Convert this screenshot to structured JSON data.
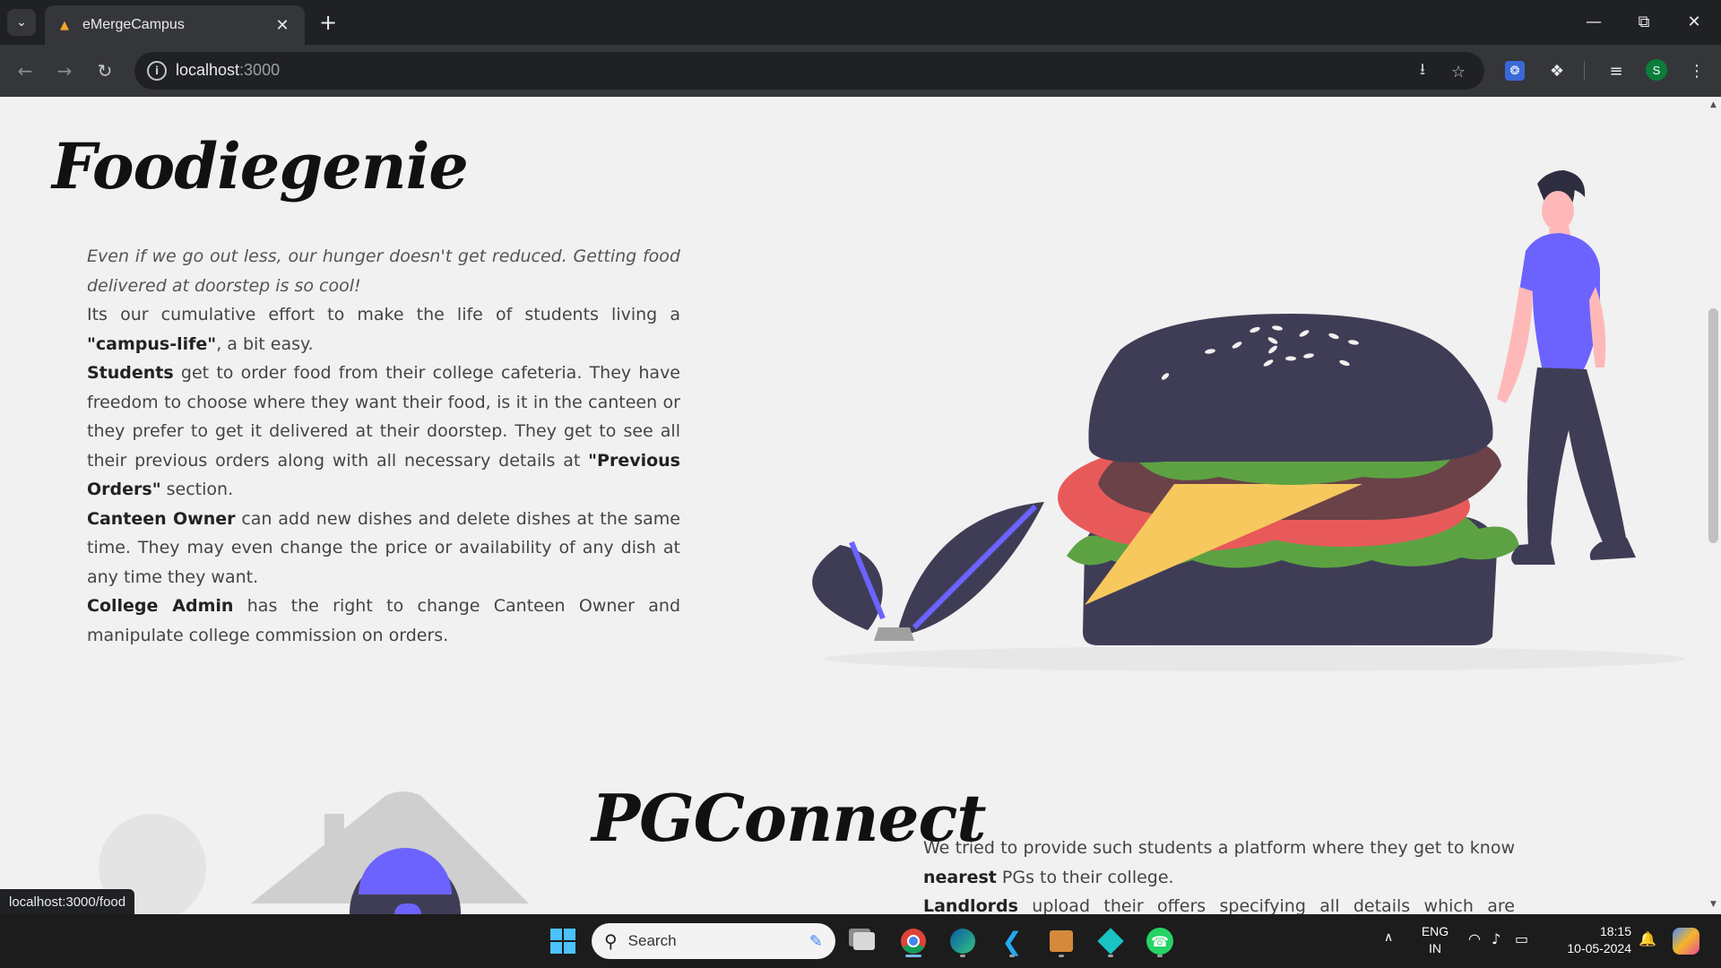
{
  "browser": {
    "tab_title": "eMergeCampus",
    "url_host": "localhost",
    "url_port": ":3000",
    "status_url": "localhost:3000/food",
    "profile_initial": "S"
  },
  "foodiegenie": {
    "title": "Foodiegenie",
    "quote": "Even if we go out less, our hunger doesn't get reduced. Getting food delivered at doorstep is so cool!",
    "p1_pre": "Its our cumulative effort to make the life of students living a ",
    "p1_bold": "\"campus-life\"",
    "p1_post": ", a bit easy.",
    "p2_bold": "Students",
    "p2_text": " get to order food from their college cafeteria. They have freedom to choose where they want their food, is it in the canteen or they prefer to get it delivered at their doorstep. They get to see all their previous orders along with all necessary details at ",
    "p2_bold2": "\"Previous Orders\"",
    "p2_post": " section.",
    "p3_bold": "Canteen Owner",
    "p3_text": " can add new dishes and delete dishes at the same time. They may even change the price or availability of any dish at any time they want.",
    "p4_bold": "College Admin",
    "p4_text": " has the right to change Canteen Owner and manipulate college commission on orders."
  },
  "pgconnect": {
    "title": "PGConnect",
    "p1_pre": "We tried to provide such students a platform where they get to know ",
    "p1_bold": "nearest",
    "p1_post": " PGs to their college.",
    "p2_bold": "Landlords",
    "p2_text": " upload their offers specifying all details which are displayed to"
  },
  "taskbar": {
    "search_label": "Search",
    "lang_top": "ENG",
    "lang_bottom": "IN",
    "time": "18:15",
    "date": "10-05-2024"
  },
  "colors": {
    "accent_purple": "#6c63ff",
    "dark_bun": "#3f3d56",
    "lettuce": "#5da242",
    "tomato": "#e85a5a",
    "cheese": "#f7c85d"
  }
}
